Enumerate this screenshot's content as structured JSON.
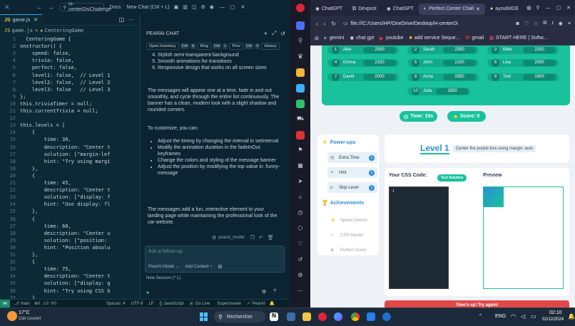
{
  "vscode": {
    "title_search": "H-centerDivChalenge",
    "title_docs": "Docs",
    "title_newchat": "New Chat (Ctrl + L)",
    "tab_file": "game.js",
    "breadcrumb_file": "game.js",
    "breadcrumb_sep": ">",
    "breadcrumb_class": "CenteringGame",
    "code_lines": [
      {
        "n": "1",
        "t": "  CenteringGame {"
      },
      {
        "n": "2",
        "t": "onstructor() {"
      },
      {
        "n": "3",
        "t": "    speed: false,"
      },
      {
        "n": "4",
        "t": "    trivia: false,"
      },
      {
        "n": "5",
        "t": "    perfect: false,"
      },
      {
        "n": "6",
        "t": "    level1: false,  // Level 1"
      },
      {
        "n": "7",
        "t": "    level2: false,  // Level 2"
      },
      {
        "n": "8",
        "t": "    level3: false   // Level 3"
      },
      {
        "n": "9",
        "t": "};"
      },
      {
        "n": "10",
        "t": "this.triviaTimer = null;"
      },
      {
        "n": "11",
        "t": "this.currentTrivia = null;"
      },
      {
        "n": "12",
        "t": ""
      },
      {
        "n": "13",
        "t": "this.levels = ["
      },
      {
        "n": "14",
        "t": "    {"
      },
      {
        "n": "15",
        "t": "        time: 30,"
      },
      {
        "n": "16",
        "t": "        description: \"Center t"
      },
      {
        "n": "17",
        "t": "        solution: [\"margin-lef"
      },
      {
        "n": "18",
        "t": "        hint: \"Try using margi"
      },
      {
        "n": "19",
        "t": "    },"
      },
      {
        "n": "20",
        "t": "    {"
      },
      {
        "n": "21",
        "t": "        time: 45,"
      },
      {
        "n": "22",
        "t": "        description: \"Center t"
      },
      {
        "n": "23",
        "t": "        solution: [\"display: f"
      },
      {
        "n": "24",
        "t": "        hint: \"Use display: fl"
      },
      {
        "n": "25",
        "t": "    },"
      },
      {
        "n": "26",
        "t": "    {"
      },
      {
        "n": "27",
        "t": "        time: 60,"
      },
      {
        "n": "28",
        "t": "        description: \"Center u"
      },
      {
        "n": "29",
        "t": "        solution: [\"position:"
      },
      {
        "n": "30",
        "t": "        hint: \"Position absolu"
      },
      {
        "n": "31",
        "t": "    },"
      },
      {
        "n": "32",
        "t": "    {"
      },
      {
        "n": "33",
        "t": "        time: 75,"
      },
      {
        "n": "34",
        "t": "        description: \"Center t"
      },
      {
        "n": "35",
        "t": "        solution: [\"display: g"
      },
      {
        "n": "36",
        "t": "        hint: \"Try using CSS G"
      },
      {
        "n": "37",
        "t": "    },"
      }
    ],
    "chat": {
      "header": "PEARAI CHAT",
      "chips": [
        "Open Inventory",
        "Ctrl",
        "E",
        "Bing",
        "Ctrl",
        "L",
        "Prev",
        "Ctrl",
        "0",
        "History"
      ],
      "bullets_top": [
        "Stylish semi-transparent background",
        "Smooth animations for transitions",
        "Responsive design that works on all screen sizes"
      ],
      "para1": "The messages will appear one at a time, fade in and out smoothly, and cycle through the entire list continuously. The banner has a clean, modern look with a slight shadow and rounded corners.",
      "para2": "To customize, you can:",
      "bullets_custom": [
        "Adjust the timing by changing the interval in setInterval",
        "Modify the animation duration in the fadeInOut keyframes",
        "Change the colors and styling of the message banner",
        "Adjust the position by modifying the top value in .funny-message"
      ],
      "para3": "The messages add a fun, interactive element to your landing page while maintaining the professional look of the car website.",
      "model_tag": "pearai_model",
      "input_placeholder": "Ask a follow-up",
      "model_select": "PearAI Model",
      "add_context": "Add Context +",
      "new_session": "New Session (^ L)"
    },
    "status": {
      "branch": "main",
      "errors": "0",
      "warnings": "0",
      "remote": "0",
      "spaces": "Spaces: 4",
      "encoding": "UTF-8",
      "eol": "LF",
      "lang": "JavaScript",
      "golive": "Go Live",
      "supermaven": "Supermaven",
      "pearai": "PearAI"
    }
  },
  "opera": {
    "tabs": [
      "ChatGPT",
      "Devpost",
      "ChatGPT",
      "Perfect Center Chall",
      "ayoub003l"
    ],
    "url": "file:///C:/Users/HP/OneDrive/Desktop/H-centerDi",
    "bookmarks": [
      "gemini",
      "chat gpt",
      "youtube",
      "add service Seque...",
      "gmail",
      "START HERE | Softw..."
    ]
  },
  "game": {
    "leaderboard": [
      {
        "rank": "1",
        "name": "Alex",
        "score": "2500"
      },
      {
        "rank": "2",
        "name": "Sarah",
        "score": "2350"
      },
      {
        "rank": "3",
        "name": "Mike",
        "score": "2200"
      },
      {
        "rank": "4",
        "name": "Emma",
        "score": "2150"
      },
      {
        "rank": "5",
        "name": "John",
        "score": "2100"
      },
      {
        "rank": "6",
        "name": "Lisa",
        "score": "2050"
      },
      {
        "rank": "7",
        "name": "David",
        "score": "2000"
      },
      {
        "rank": "8",
        "name": "Anna",
        "score": "1950"
      },
      {
        "rank": "9",
        "name": "Tom",
        "score": "1900"
      },
      {
        "rank": "10",
        "name": "Julia",
        "score": "1850"
      }
    ],
    "time": "Time: 10s",
    "score": "Score: 0",
    "powerups_title": "Power-ups",
    "powerups": [
      {
        "label": "Extra Time",
        "count": "1"
      },
      {
        "label": "Hint",
        "count": "1"
      },
      {
        "label": "Skip Level",
        "count": "1"
      }
    ],
    "achievements_title": "Achievements",
    "achievements": [
      "Speed Demon",
      "CSS Master",
      "Perfect Score"
    ],
    "level_title": "Level 1",
    "level_desc": "Center the purple box using margin: auto",
    "css_code_label": "Your CSS Code:",
    "test_button": "Test Solution",
    "editor_line": "1",
    "preview_label": "Preview",
    "timeup": "Time's up! Try again!"
  },
  "taskbar": {
    "temp": "17°C",
    "weather": "Ciel couvert",
    "search": "Rechercher",
    "lang": "ENG",
    "time": "02:10",
    "date": "02/12/2024"
  },
  "colors": {
    "teal": "#10a98a",
    "vs_bg": "#0b2a36",
    "accent_blue": "#2d8fd5"
  }
}
